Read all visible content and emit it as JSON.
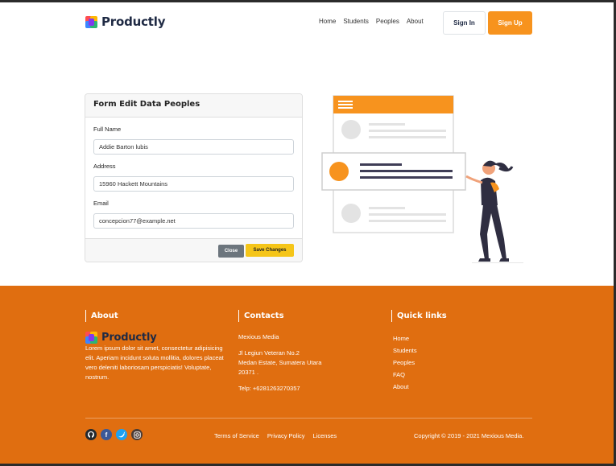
{
  "brand": {
    "name": "Productly"
  },
  "nav": {
    "links": [
      "Home",
      "Students",
      "Peoples",
      "About"
    ],
    "signin_label": "Sign In",
    "signup_label": "Sign Up"
  },
  "form": {
    "title": "Form Edit Data Peoples",
    "fields": [
      {
        "label": "Full Name",
        "value": "Addie Barton lubis"
      },
      {
        "label": "Address",
        "value": "15960 Hackett Mountains"
      },
      {
        "label": "Email",
        "value": "concepcion77@example.net"
      }
    ],
    "close_label": "Close",
    "save_label": "Save Changes"
  },
  "footer": {
    "about": {
      "title": "About",
      "text": "Lorem ipsum dolor sit amet, consectetur adipisicing elit. Aperiam incidunt soluta mollitia, dolores placeat vero deleniti laboriosam perspiciatis! Voluptate, nostrum."
    },
    "contacts": {
      "title": "Contacts",
      "company": "Mexious Media",
      "address_line1": "Jl Legiun Veteran No.2",
      "address_line2": "Medan Estate, Sumatera Utara",
      "address_line3": "20371 .",
      "phone": "Telp: +6281263270357"
    },
    "quick_links": {
      "title": "Quick links",
      "items": [
        "Home",
        "Students",
        "Peoples",
        "FAQ",
        "About"
      ]
    },
    "legal_links": [
      "Terms of Service",
      "Privacy Policy",
      "Licenses"
    ],
    "copyright": "Copyright © 2019 - 2021 Mexious Media.",
    "socials": [
      "github-icon",
      "facebook-icon",
      "twitter-icon",
      "instagram-icon"
    ]
  },
  "colors": {
    "accent": "#f7931e",
    "footer_bg": "#e06e10",
    "save_button": "#f5c518",
    "close_button": "#6c757d",
    "brand_text": "#1f2a44"
  }
}
